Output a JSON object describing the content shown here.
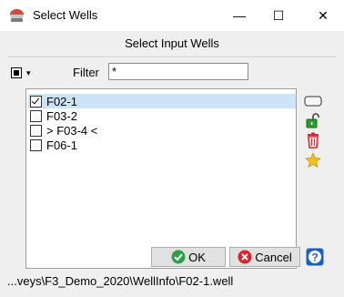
{
  "window": {
    "title": "Select Wells",
    "app_icon": "opendtect-icon",
    "controls": {
      "minimize": "—",
      "maximize": "☐",
      "close": "✕"
    }
  },
  "dialog": {
    "header": "Select Input Wells",
    "filter": {
      "label": "Filter",
      "value": "*"
    },
    "wells": [
      {
        "label": "F02-1",
        "checked": true,
        "selected": true
      },
      {
        "label": "F03-2",
        "checked": false,
        "selected": false
      },
      {
        "label": "> F03-4 <",
        "checked": false,
        "selected": false
      },
      {
        "label": "F06-1",
        "checked": false,
        "selected": false
      }
    ],
    "side_tools": [
      "rectangle-icon",
      "unlock-icon",
      "trash-icon",
      "star-icon"
    ],
    "buttons": {
      "ok": "OK",
      "cancel": "Cancel"
    },
    "help_icon": "help-icon",
    "status": "...veys\\F3_Demo_2020\\WellInfo\\F02-1.well"
  },
  "colors": {
    "selection": "#cde3f7",
    "ok_icon": "#2e9e4c",
    "cancel_icon": "#d9262b",
    "help_icon": "#1f5fbf",
    "trash": "#d9262b",
    "lock": "#2d9a2f",
    "star": "#f5c21a"
  }
}
